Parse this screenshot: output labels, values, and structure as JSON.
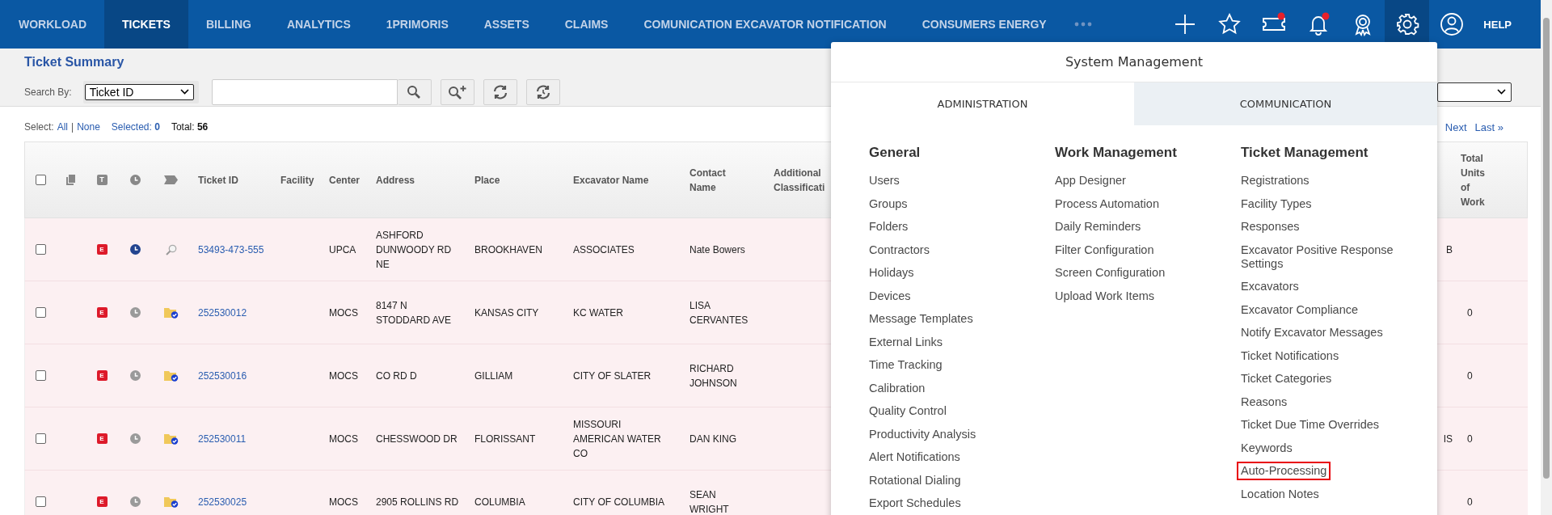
{
  "nav": {
    "tabs": [
      {
        "label": "WORKLOAD",
        "selected": false
      },
      {
        "label": "TICKETS",
        "selected": true
      },
      {
        "label": "BILLING",
        "selected": false
      },
      {
        "label": "ANALYTICS",
        "selected": false
      },
      {
        "label": "1PRIMORIS",
        "selected": false
      },
      {
        "label": "ASSETS",
        "selected": false
      },
      {
        "label": "CLAIMS",
        "selected": false
      },
      {
        "label": "COMUNICATION EXCAVATOR NOTIFICATION",
        "selected": false
      },
      {
        "label": "CONSUMERS ENERGY",
        "selected": false
      }
    ],
    "icons": [
      {
        "kind": "plus",
        "selected": false,
        "badge": false
      },
      {
        "kind": "star",
        "selected": false,
        "badge": false
      },
      {
        "kind": "ticket",
        "selected": false,
        "badge": true
      },
      {
        "kind": "bell",
        "selected": false,
        "badge": true
      },
      {
        "kind": "award",
        "selected": false,
        "badge": false
      },
      {
        "kind": "gear",
        "selected": true,
        "badge": false
      },
      {
        "kind": "user",
        "selected": false,
        "badge": false
      }
    ],
    "help": "HELP"
  },
  "page": {
    "title": "Ticket Summary",
    "search_label": "Search By:",
    "search_by": "Ticket ID"
  },
  "select_bar": {
    "label": "Select:",
    "all": "All",
    "separator": "|",
    "none": "None",
    "selected_label": "Selected:",
    "selected_count": "0",
    "total_label": "Total:",
    "total_count": "56"
  },
  "pagination": [
    "Next",
    "Last »"
  ],
  "table": {
    "select_all_checked": false,
    "header_badge": "T",
    "columns": [
      "Ticket ID",
      "Facility",
      "Center",
      "Address",
      "Place",
      "Excavator Name",
      "Contact Name",
      "Additional Classificati",
      "Total Units of Work"
    ],
    "rows": [
      {
        "checked": false,
        "badge": "E",
        "clock_active": true,
        "kind": "magnifier",
        "ticket_id": "53493-473-555",
        "center": "UPCA",
        "address": "ASHFORD DUNWOODY RD NE",
        "place": "BROOKHAVEN",
        "excavator": "ASSOCIATES",
        "contact": "Nate Bowers",
        "column_14": "B"
      },
      {
        "checked": false,
        "badge": "E",
        "clock_active": false,
        "kind": "folder",
        "ticket_id": "252530012",
        "center": "MOCS",
        "address": "8147 N STODDARD AVE",
        "place": "KANSAS CITY",
        "excavator": "KC WATER",
        "contact": "LISA CERVANTES",
        "total_units": "0"
      },
      {
        "checked": false,
        "badge": "E",
        "clock_active": false,
        "kind": "folder",
        "ticket_id": "252530016",
        "center": "MOCS",
        "address": "CO RD D",
        "place": "GILLIAM",
        "excavator": "CITY OF SLATER",
        "contact": "RICHARD JOHNSON",
        "total_units": "0"
      },
      {
        "checked": false,
        "badge": "E",
        "clock_active": false,
        "kind": "folder",
        "ticket_id": "252530011",
        "center": "MOCS",
        "address": "CHESSWOOD DR",
        "place": "FLORISSANT",
        "excavator": "MISSOURI AMERICAN WATER CO",
        "contact": "DAN KING",
        "column_14": "IS",
        "total_units": "0"
      },
      {
        "checked": false,
        "badge": "E",
        "clock_active": false,
        "kind": "folder",
        "ticket_id": "252530025",
        "center": "MOCS",
        "address": "2905 ROLLINS RD",
        "place": "COLUMBIA",
        "excavator": "CITY OF COLUMBIA",
        "contact": "SEAN WRIGHT",
        "total_units": "0"
      }
    ]
  },
  "system_menu": {
    "title": "System Management",
    "tabs": [
      {
        "label": "ADMINISTRATION",
        "selected": true
      },
      {
        "label": "COMMUNICATION",
        "selected": false
      }
    ],
    "columns": [
      {
        "heading": "General",
        "items": [
          {
            "label": "Users",
            "outlined": false
          },
          {
            "label": "Groups",
            "outlined": false
          },
          {
            "label": "Folders",
            "outlined": false
          },
          {
            "label": "Contractors",
            "outlined": false
          },
          {
            "label": "Holidays",
            "outlined": false
          },
          {
            "label": "Devices",
            "outlined": false
          },
          {
            "label": "Message Templates",
            "outlined": false
          },
          {
            "label": "External Links",
            "outlined": false
          },
          {
            "label": "Time Tracking",
            "outlined": false
          },
          {
            "label": "Calibration",
            "outlined": false
          },
          {
            "label": "Quality Control",
            "outlined": false
          },
          {
            "label": "Productivity Analysis",
            "outlined": false
          },
          {
            "label": "Alert Notifications",
            "outlined": false
          },
          {
            "label": "Rotational Dialing",
            "outlined": false
          },
          {
            "label": "Export Schedules",
            "outlined": false
          }
        ]
      },
      {
        "heading": "Work Management",
        "items": [
          {
            "label": "App Designer",
            "outlined": false
          },
          {
            "label": "Process Automation",
            "outlined": false
          },
          {
            "label": "Daily Reminders",
            "outlined": false
          },
          {
            "label": "Filter Configuration",
            "outlined": false
          },
          {
            "label": "Screen Configuration",
            "outlined": false
          },
          {
            "label": "Upload Work Items",
            "outlined": false
          }
        ]
      },
      {
        "heading": "Ticket Management",
        "items": [
          {
            "label": "Registrations",
            "outlined": false
          },
          {
            "label": "Facility Types",
            "outlined": false
          },
          {
            "label": "Responses",
            "outlined": false
          },
          {
            "label": "Excavator Positive Response Settings",
            "outlined": false
          },
          {
            "label": "Excavators",
            "outlined": false
          },
          {
            "label": "Excavator Compliance",
            "outlined": false
          },
          {
            "label": "Notify Excavator Messages",
            "outlined": false
          },
          {
            "label": "Ticket Notifications",
            "outlined": false
          },
          {
            "label": "Ticket Categories",
            "outlined": false
          },
          {
            "label": "Reasons",
            "outlined": false
          },
          {
            "label": "Ticket Due Time Overrides",
            "outlined": false
          },
          {
            "label": "Keywords",
            "outlined": false
          },
          {
            "label": "Auto-Processing",
            "outlined": true
          },
          {
            "label": "Location Notes",
            "outlined": false
          }
        ]
      }
    ]
  }
}
